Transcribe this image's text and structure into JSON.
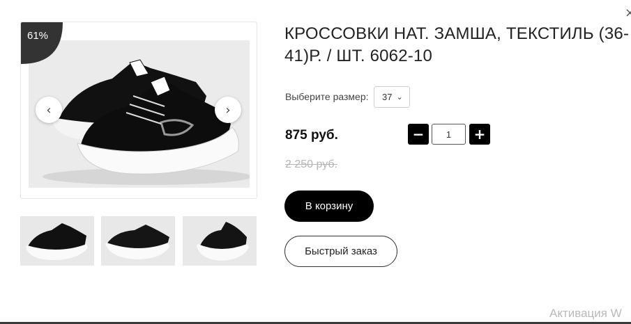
{
  "product": {
    "title": "КРОССОВКИ НАТ. ЗАМША, ТЕКСТИЛЬ (36-41)Р. / ШТ. 6062-10",
    "discount_badge": "61%",
    "size_label": "Выберите размер:",
    "size_selected": "37",
    "price": "875 руб.",
    "old_price": "2 250 руб.",
    "quantity": "1"
  },
  "buttons": {
    "add_to_cart": "В корзину",
    "quick_order": "Быстрый заказ",
    "close": "×",
    "prev": "‹",
    "next": "›",
    "minus": "−",
    "plus": "+"
  },
  "gallery": {
    "thumbnails": [
      "thumbnail-1",
      "thumbnail-2",
      "thumbnail-3"
    ]
  },
  "system": {
    "watermark": "Активация W"
  },
  "colors": {
    "accent": "#000000",
    "badge": "#333333",
    "old_price": "#b5b5b5"
  }
}
